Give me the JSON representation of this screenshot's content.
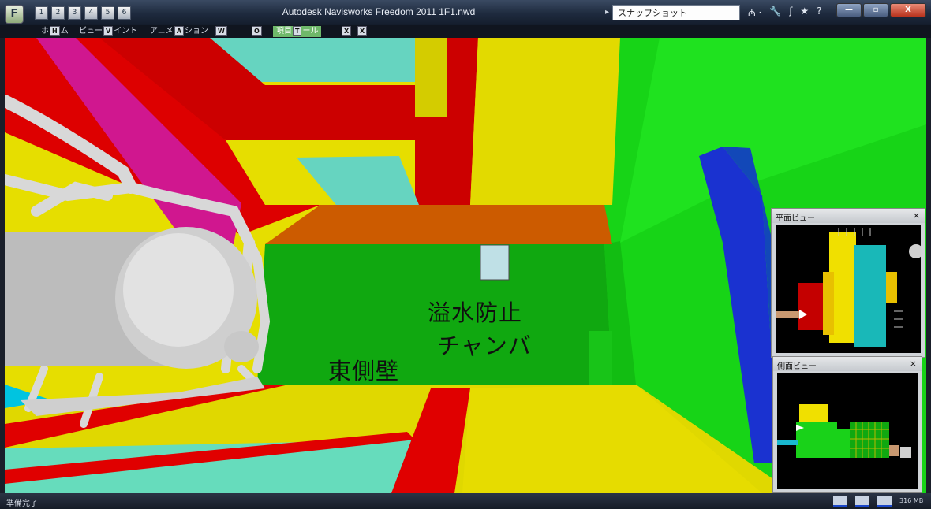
{
  "titlebar": {
    "app_button": "F",
    "qat_icons": [
      "1",
      "2",
      "3",
      "4",
      "5",
      "6"
    ],
    "title": "Autodesk Navisworks Freedom 2011    1F1.nwd",
    "search_placeholder": "スナップショット",
    "tools": [
      "₼ ·",
      "🔧",
      "ʃ",
      "★",
      "?"
    ],
    "buttons": {
      "minimize": "—",
      "maximize": "▫",
      "close": "X"
    }
  },
  "ribbon": {
    "tabs": [
      {
        "label": "ホ",
        "key": "H",
        "suffix": "ム"
      },
      {
        "label": "ビュー",
        "key": "V",
        "suffix": "イント"
      },
      {
        "label": "アニメ",
        "key": "A",
        "suffix": "ション"
      },
      {
        "label": "",
        "key": "W",
        "suffix": ""
      },
      {
        "label": "",
        "key": "O",
        "suffix": ""
      },
      {
        "label": "項目",
        "key": "T",
        "suffix": "ール"
      },
      {
        "label": "",
        "key": "X",
        "suffix": ""
      },
      {
        "label": "",
        "key": "X",
        "suffix": ""
      }
    ]
  },
  "viewport": {
    "labels": {
      "chamber_line1": "溢水防止",
      "chamber_line2": "チャンバ",
      "east_wall": "東側壁"
    }
  },
  "plan_view": {
    "title": "平面ビュー",
    "close": "×"
  },
  "side_view": {
    "title": "側面ビュー",
    "close": "×"
  },
  "statusbar": {
    "text": "準備完了",
    "memory": "316 MB"
  }
}
